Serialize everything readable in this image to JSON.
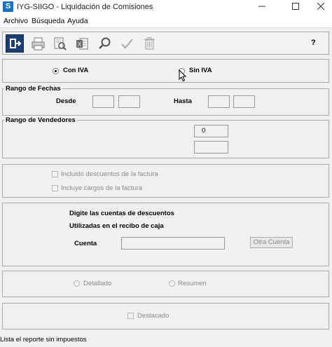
{
  "window": {
    "title": "IYG-SIIGO - Liquidación de Comisiones",
    "app_icon": "S"
  },
  "menu": {
    "archivo": "Archivo",
    "busqueda": "Búsqueda",
    "ayuda": "Ayuda"
  },
  "toolbar": {
    "help_label": "?"
  },
  "iva": {
    "con_iva": "Con IVA",
    "sin_iva": "Sin IVA",
    "selected": "Con IVA"
  },
  "fechas": {
    "legend": "Rango de Fechas",
    "desde_label": "Desde",
    "hasta_label": "Hasta"
  },
  "vendedores": {
    "legend": "Rango de Vendedores",
    "from_value": "0",
    "to_value": ""
  },
  "options": {
    "descuentos_label": "Incluido descuentos de la factura",
    "descuentos_underline": "d",
    "cargos_label": "Incluye cargos de la factura",
    "cargos_underline": "c"
  },
  "cuentas": {
    "line1": "Digite las cuentas de descuentos",
    "line2": "Utilizadas en el recibo de caja",
    "cuenta_label": "Cuenta",
    "cuenta_value": "",
    "otra_cuenta_button": "Otra Cuenta"
  },
  "tipo": {
    "detallado": "Detallado",
    "resumen": "Resumen"
  },
  "destacado": {
    "label": "Destacado"
  },
  "status": {
    "text": "Lista el reporte sin impuestos"
  }
}
